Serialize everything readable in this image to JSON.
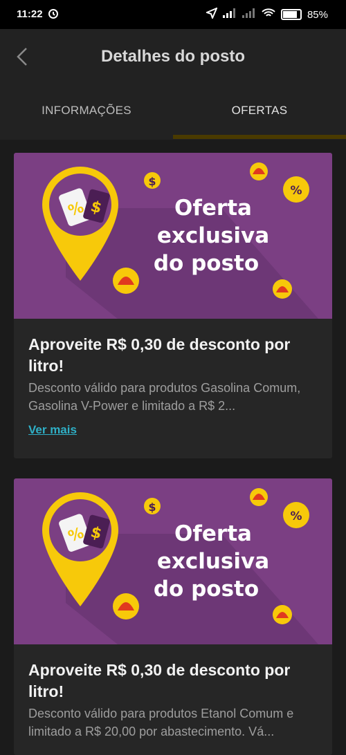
{
  "status": {
    "time": "11:22",
    "battery": "85%"
  },
  "header": {
    "title": "Detalhes do posto"
  },
  "tabs": [
    {
      "label": "INFORMAÇÕES"
    },
    {
      "label": "OFERTAS"
    }
  ],
  "offers": [
    {
      "banner_lines": [
        "Oferta",
        "exclusiva",
        "do posto"
      ],
      "title": "Aproveite R$ 0,30 de desconto por litro!",
      "description": "Desconto válido para produtos Gasolina Comum, Gasolina V-Power e limitado a R$ 2...",
      "link": "Ver mais"
    },
    {
      "banner_lines": [
        "Oferta",
        "exclusiva",
        "do posto"
      ],
      "title": "Aproveite R$ 0,30 de desconto por litro!",
      "description": "Desconto válido para produtos Etanol Comum e limitado a R$ 20,00 por abastecimento. Vá..."
    }
  ],
  "colors": {
    "banner_purple": "#7b3f83",
    "accent_yellow": "#f7c90a",
    "link": "#2fb0c7",
    "background": "#1b1b1b"
  }
}
